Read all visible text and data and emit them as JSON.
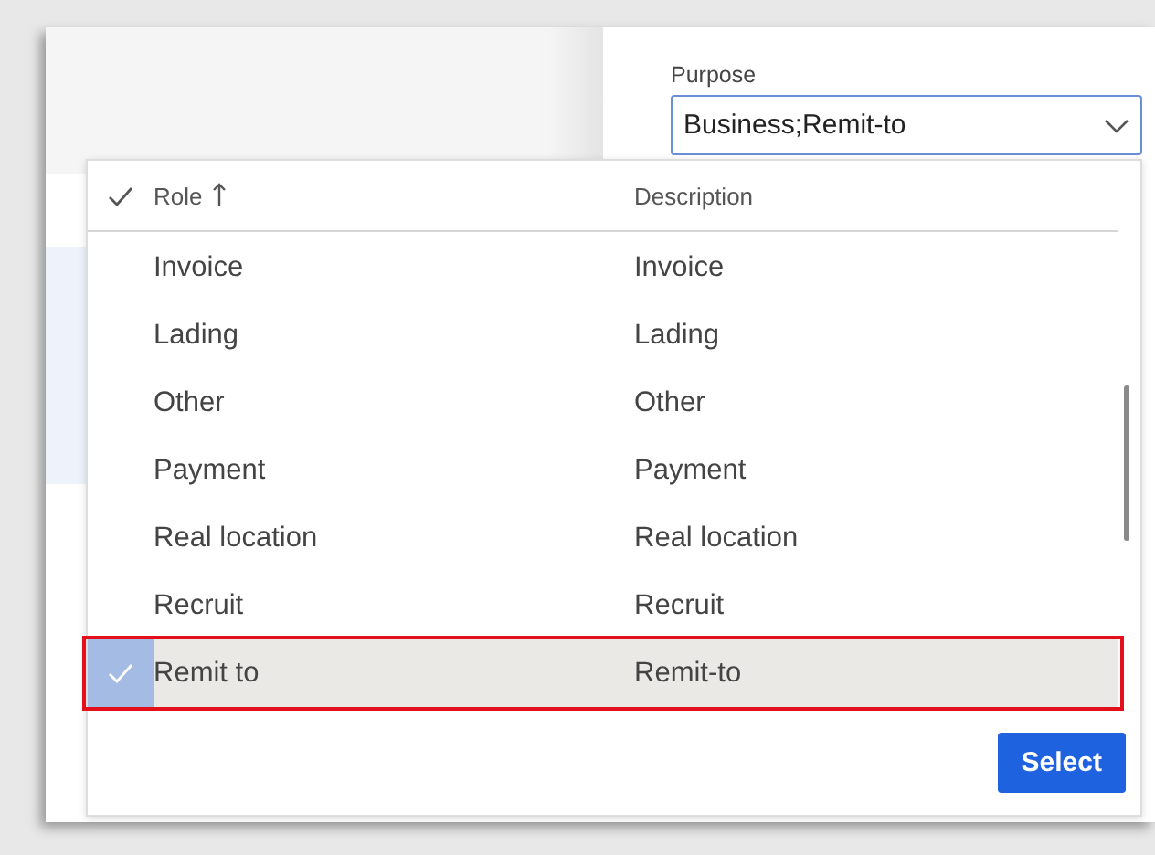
{
  "field": {
    "label": "Purpose",
    "value": "Business;Remit-to"
  },
  "lookup": {
    "columns": [
      {
        "label": "Role",
        "sorted": true
      },
      {
        "label": "Description",
        "sorted": false
      }
    ],
    "rows": [
      {
        "role": "Invoice",
        "description": "Invoice",
        "selected": false,
        "highlighted": false
      },
      {
        "role": "Lading",
        "description": "Lading",
        "selected": false,
        "highlighted": false
      },
      {
        "role": "Other",
        "description": "Other",
        "selected": false,
        "highlighted": false
      },
      {
        "role": "Payment",
        "description": "Payment",
        "selected": false,
        "highlighted": false
      },
      {
        "role": "Real location",
        "description": "Real location",
        "selected": false,
        "highlighted": false
      },
      {
        "role": "Recruit",
        "description": "Recruit",
        "selected": false,
        "highlighted": false
      },
      {
        "role": "Remit to",
        "description": "Remit-to",
        "selected": true,
        "highlighted": true
      }
    ],
    "button": "Select"
  }
}
